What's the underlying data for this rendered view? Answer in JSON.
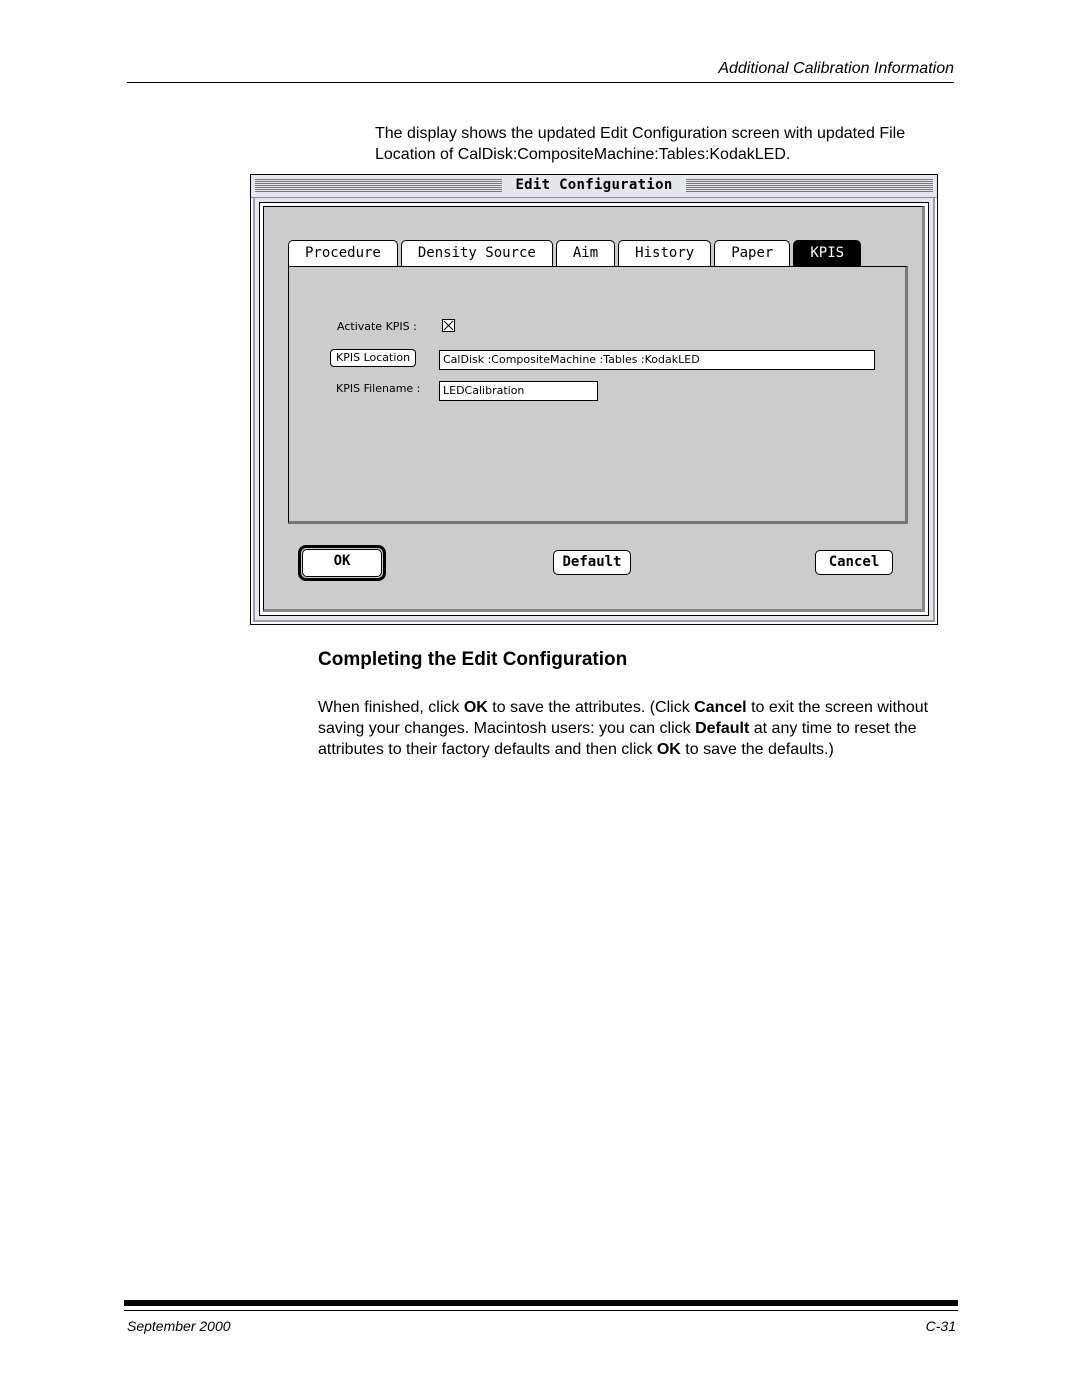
{
  "header": {
    "section_title": "Additional Calibration Information"
  },
  "intro": "The display shows the updated Edit Configuration screen with updated File Location of CalDisk:CompositeMachine:Tables:KodakLED.",
  "window": {
    "title": "Edit Configuration",
    "tabs": [
      {
        "label": "Procedure",
        "active": false
      },
      {
        "label": "Density Source",
        "active": false
      },
      {
        "label": "Aim",
        "active": false
      },
      {
        "label": "History",
        "active": false
      },
      {
        "label": "Paper",
        "active": false
      },
      {
        "label": "KPIS",
        "active": true
      }
    ],
    "activate_label": "Activate KPIS :",
    "activate_checked": true,
    "location_button": "KPIS Location",
    "location_value": "CalDisk :CompositeMachine :Tables :KodakLED",
    "filename_label": "KPIS Filename :",
    "filename_value": "LEDCalibration",
    "buttons": {
      "ok": "OK",
      "default": "Default",
      "cancel": "Cancel"
    }
  },
  "section": {
    "heading": "Completing the Edit Configuration",
    "p1": "When finished, click ",
    "b1": "OK",
    "p2": " to save the attributes. (Click ",
    "b2": "Cancel",
    "p3": " to exit the screen without saving your changes. Macintosh users: you can click ",
    "b3": "Default",
    "p4": " at any time to reset the attributes to their factory defaults and then click ",
    "b4": "OK",
    "p5": " to save the defaults.)"
  },
  "footer": {
    "date": "September 2000",
    "page": "C-31"
  }
}
